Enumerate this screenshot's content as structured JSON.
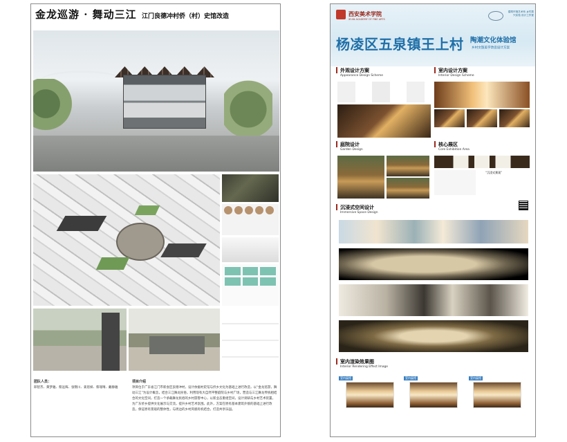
{
  "left_poster": {
    "title": "金龙巡游 · 舞动三江",
    "subtitle": "江门良德冲村侨（村）史馆改造",
    "team_label": "团队人员：",
    "team_names": "邱智杰、黄梦雅、蔡远辉、张锦川、姜思妍、蔡瑞晴、戴静雅",
    "intro_label": "项目介绍",
    "intro_text": "项目位于广东省江门市新会区良德冲村，设计依据村史馆与侨乡文化为基础上进行改造，以“金龙巡游，舞动三江”为设计概念，结合三江舞龙民俗，利用现有大自然平整庭院与乡村广场，营造与三江舞龙传统相结合的文化空间，打造一个承载舞龙民俗的乡村游客中心，以新业态重组空间，设计调研与乡村艺术装置，为广东侨乡提供文化展示与交流，提升乡村艺术氛围。此外，方案在原有基本建筑外貌的基础上进行改造，保证原有景观的整体性，与周边的乡村风貌有机结合，打造共享乐园。"
  },
  "right_poster": {
    "school_name": "西安美术学院",
    "school_name_en": "XI'AN ACADEMY OF FINE ARTS",
    "org_text": "建筑环境艺术系 乡村振兴实验 设计工作室",
    "main_title": "杨凌区五泉镇王上村",
    "side_title": "陶潮文化体验馆",
    "side_subtitle": "乡村文旅美学改造设计方案",
    "sections": {
      "appearance": {
        "title": "外观设计方案",
        "subtitle": "Appearance Design Scheme"
      },
      "interior": {
        "title": "室内设计方案",
        "subtitle": "Interior Design Scheme"
      },
      "garden": {
        "title": "庭院设计",
        "subtitle": "Garden Design"
      },
      "core": {
        "title": "核心展区",
        "subtitle": "Core Exhibition Area"
      },
      "immersive": {
        "title": "沉浸式空间设计",
        "subtitle": "Immersive Space Design"
      },
      "rendering": {
        "title": "室内渲染效果图",
        "subtitle": "Interior Rendering Effect Image"
      }
    },
    "core_label": "“沉浸式景观”",
    "render_captions": [
      "室内展馆",
      "室内展馆",
      "室内展馆"
    ]
  }
}
